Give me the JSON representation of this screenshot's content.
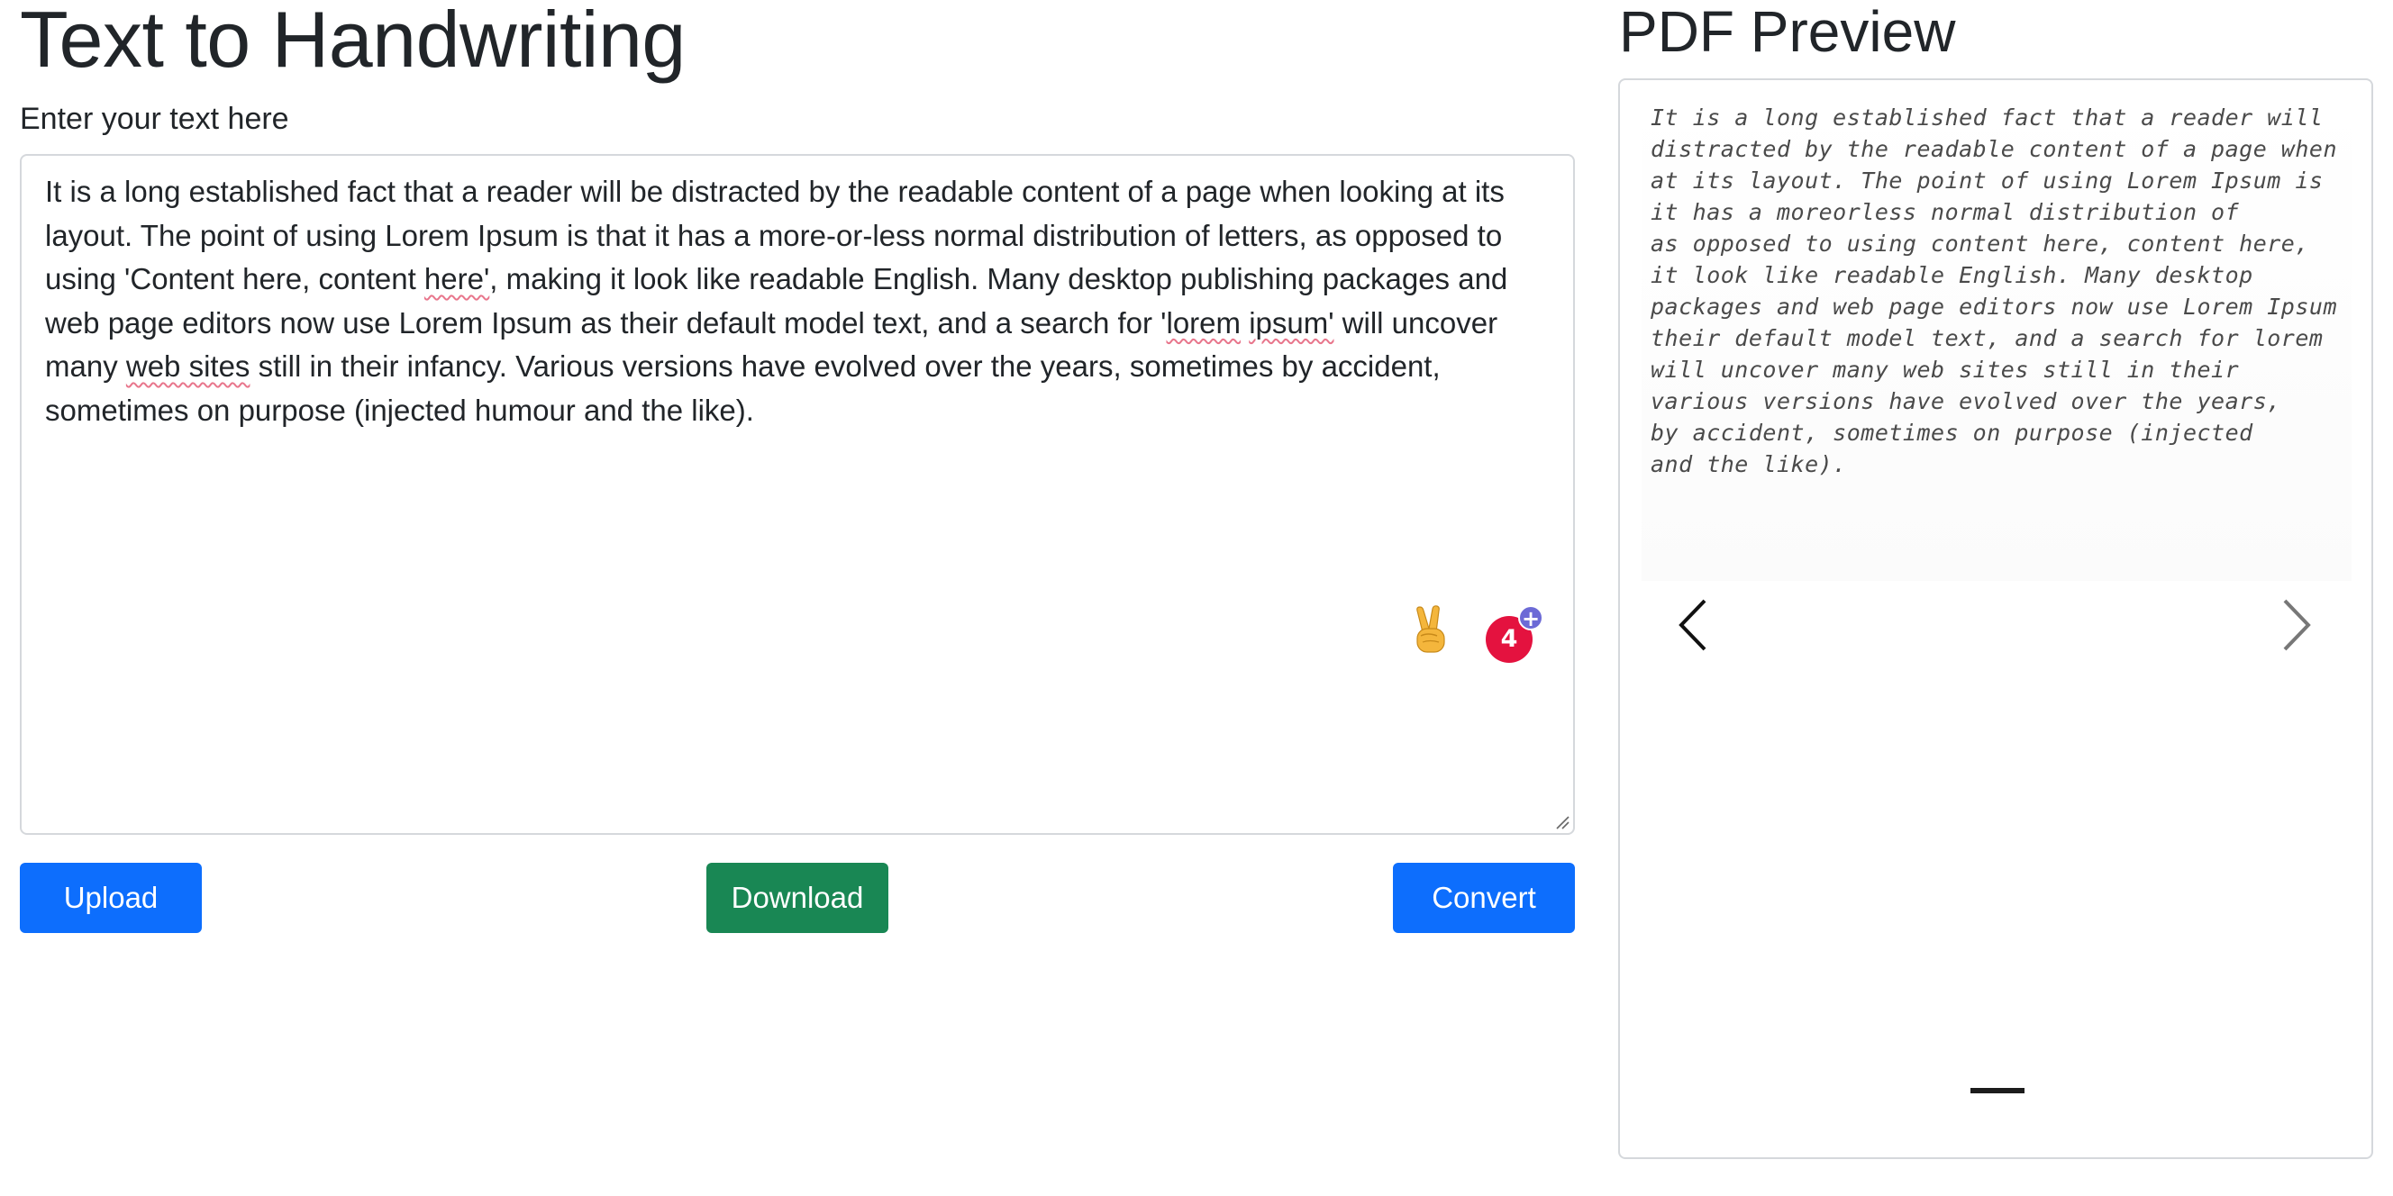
{
  "header": {
    "title": "Text to Handwriting"
  },
  "editor": {
    "label": "Enter your text here",
    "segments": [
      "It is a long established fact that a reader will be distracted by the readable content of a page when looking at its layout. The point of using Lorem Ipsum is that it has a more-or-less normal distribution of letters, as opposed to using 'Content here, content ",
      "here'",
      ", making it look like readable English. Many desktop publishing packages and web page editors now use Lorem Ipsum as their default model text, and a search for '",
      "lorem",
      " ",
      "ipsum'",
      " will uncover many ",
      "web sites",
      " still in their infancy. Various versions have evolved over the years, sometimes by accident, sometimes on purpose (injected humour and the like)."
    ],
    "extension_badge_count": "4",
    "extension_badge_plus": "+"
  },
  "actions": {
    "upload_label": "Upload",
    "download_label": "Download",
    "convert_label": "Convert"
  },
  "preview": {
    "title": "PDF Preview",
    "lines": [
      "It is a long established fact that a reader will",
      "distracted by the readable content of a page when",
      "at its layout. The point of using Lorem Ipsum is",
      "it has a moreorless normal distribution of",
      "as opposed to using content here, content here,",
      "it look like readable English. Many desktop",
      "packages and web page editors now use Lorem Ipsum",
      "their default model text, and a search for lorem",
      "will uncover many web sites still in their",
      "various versions have evolved over the years,",
      "by accident, sometimes on purpose (injected",
      "and the like)."
    ]
  },
  "colors": {
    "primary": "#0d6efd",
    "success": "#198754",
    "badge": "#e4123f",
    "badge_plus": "#6c6ad6",
    "spellcheck": "#e8768c"
  },
  "icons": {
    "carousel_prev": "chevron-left-icon",
    "carousel_next": "chevron-right-icon",
    "extension": "peace-hand-icon"
  }
}
